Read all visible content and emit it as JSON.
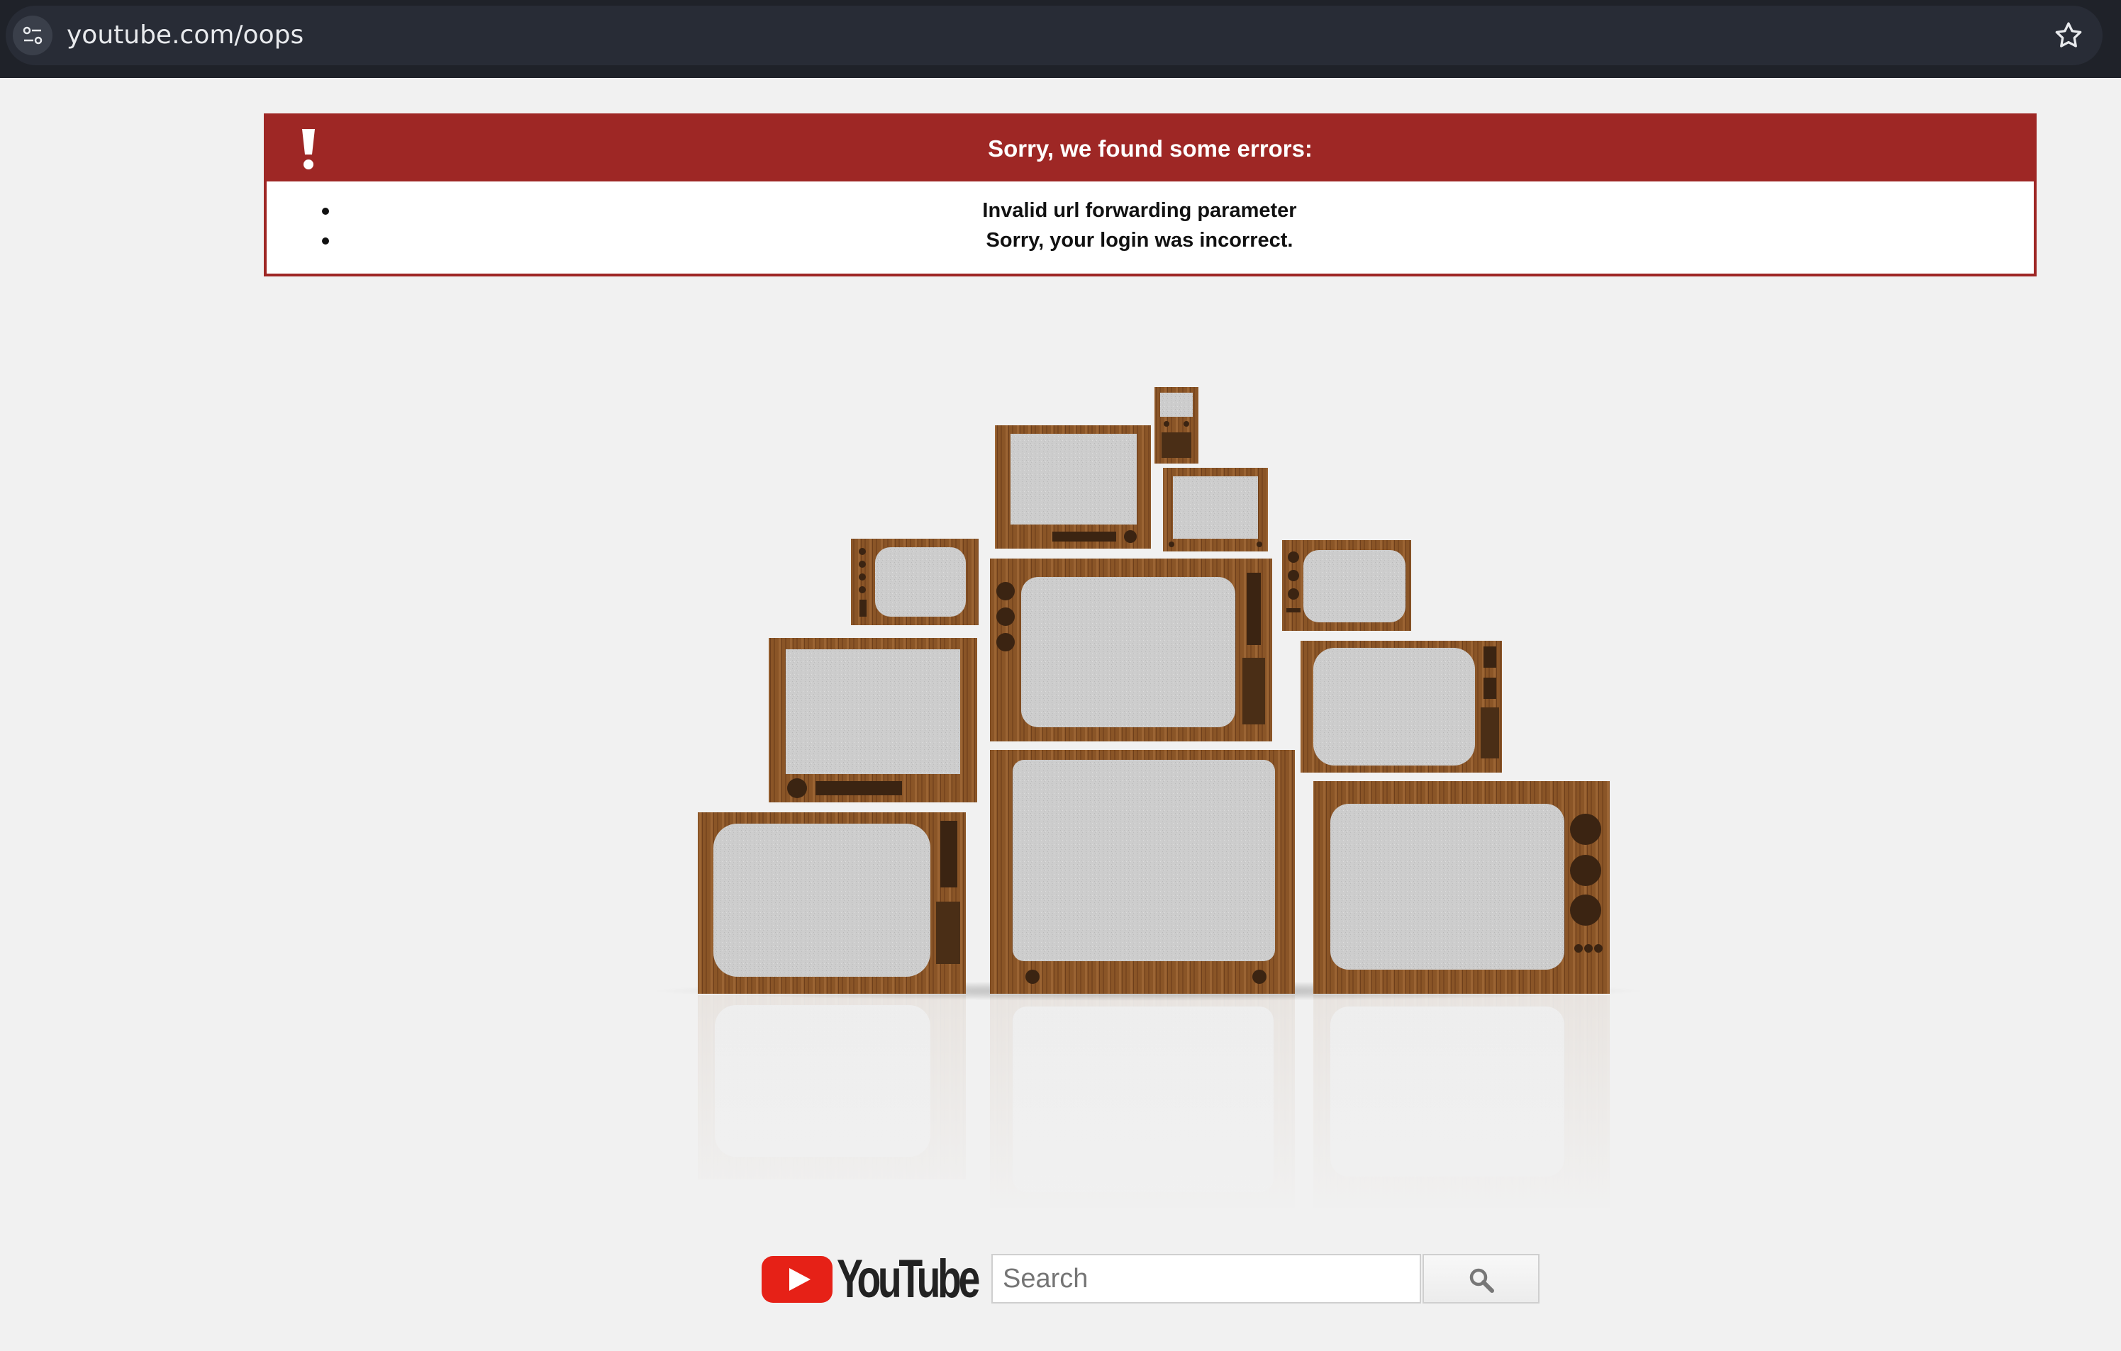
{
  "browser": {
    "url": "youtube.com/oops",
    "icons": [
      "site-settings-icon",
      "bookmark-star-icon"
    ]
  },
  "error_box": {
    "title": "Sorry, we found some errors:",
    "icon": "exclamation-icon",
    "errors": [
      "Invalid url forwarding parameter",
      "Sorry, your login was incorrect."
    ],
    "color": "#9e2725"
  },
  "illustration": {
    "name": "stack-of-vintage-tvs"
  },
  "footer": {
    "logo_text": "YouTube",
    "logo_red": "#e62117",
    "search_placeholder": "Search",
    "search_icon": "search-icon"
  }
}
